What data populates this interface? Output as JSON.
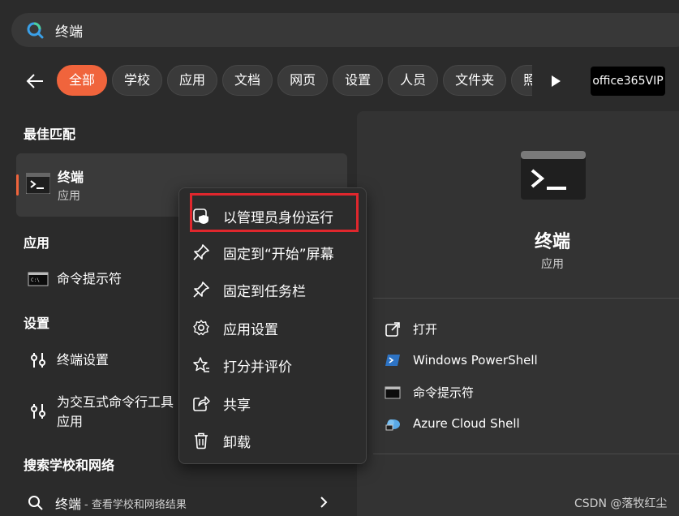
{
  "search": {
    "query": "终端"
  },
  "filters": {
    "chips": [
      "全部",
      "学校",
      "应用",
      "文档",
      "网页",
      "设置",
      "人员",
      "文件夹",
      "照"
    ],
    "promo": "office365VIP"
  },
  "left": {
    "best_match_heading": "最佳匹配",
    "best_match": {
      "name": "终端",
      "kind": "应用"
    },
    "apps_heading": "应用",
    "apps": [
      {
        "label": "命令提示符"
      }
    ],
    "settings_heading": "设置",
    "settings": [
      {
        "label": "终端设置"
      },
      {
        "label": "为交互式命令行工具",
        "label2": "应用"
      }
    ],
    "web_heading": "搜索学校和网络",
    "web": {
      "label": "终端",
      "sub": "- 查看学校和网络结果"
    }
  },
  "context_menu": {
    "items": [
      "以管理员身份运行",
      "固定到“开始”屏幕",
      "固定到任务栏",
      "应用设置",
      "打分并评价",
      "共享",
      "卸载"
    ]
  },
  "right_pane": {
    "title": "终端",
    "kind": "应用",
    "actions": [
      "打开",
      "Windows PowerShell",
      "命令提示符",
      "Azure Cloud Shell"
    ]
  },
  "watermark": "CSDN @落牧红尘",
  "colors": {
    "accent": "#f0643c",
    "highlight": "#e0272d",
    "background": "#2b2b2b"
  }
}
